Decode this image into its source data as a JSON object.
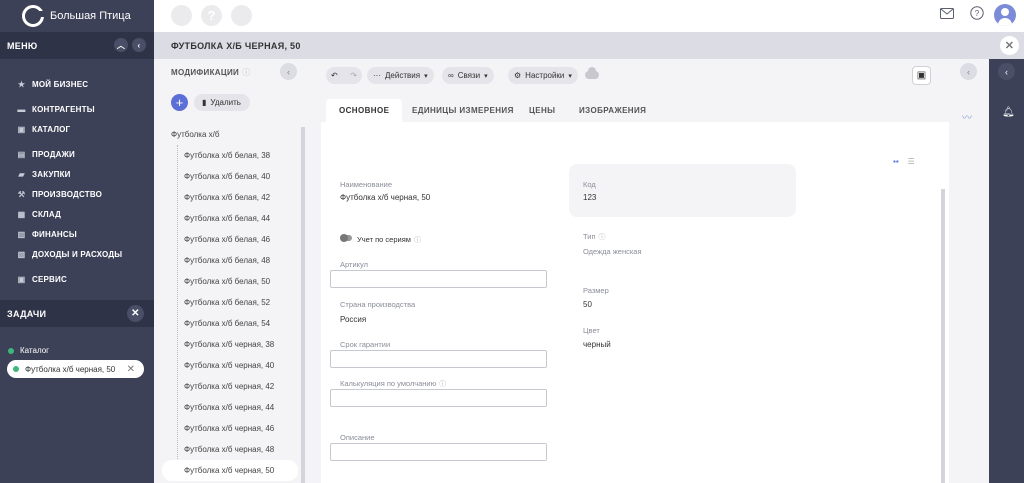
{
  "app": {
    "title": "Большая Птица"
  },
  "topbar": {
    "circle_2_label": "?",
    "mail_icon": "mail-icon",
    "help_icon": "help-icon",
    "avatar_icon": "user-avatar"
  },
  "sidebar": {
    "menu_title": "МЕНЮ",
    "items": [
      {
        "label": "МОЙ БИЗНЕС",
        "icon": "star-icon"
      },
      {
        "label": "КОНТРАГЕНТЫ",
        "icon": "people-icon"
      },
      {
        "label": "КАТАЛОГ",
        "icon": "catalog-icon"
      },
      {
        "label": "ПРОДАЖИ",
        "icon": "cart-icon"
      },
      {
        "label": "ЗАКУПКИ",
        "icon": "truck-icon"
      },
      {
        "label": "ПРОИЗВОДСТВО",
        "icon": "hammer-icon"
      },
      {
        "label": "СКЛАД",
        "icon": "warehouse-icon"
      },
      {
        "label": "ФИНАНСЫ",
        "icon": "wallet-icon"
      },
      {
        "label": "ДОХОДЫ И РАСХОДЫ",
        "icon": "chart-icon"
      },
      {
        "label": "СЕРВИС",
        "icon": "service-icon"
      }
    ],
    "tasks_title": "ЗАДАЧИ",
    "tasks": [
      {
        "label": "Каталог"
      },
      {
        "label": "Футболка х/б черная, 50"
      }
    ]
  },
  "header": {
    "title": "ФУТБОЛКА Х/Б ЧЕРНАЯ, 50"
  },
  "modifications": {
    "title": "МОДИФИКАЦИИ",
    "delete_label": "Удалить",
    "root": "Футболка х/б",
    "items": [
      "Футболка х/б белая, 38",
      "Футболка х/б белая, 40",
      "Футболка х/б белая, 42",
      "Футболка х/б белая, 44",
      "Футболка х/б белая, 46",
      "Футболка х/б белая, 48",
      "Футболка х/б белая, 50",
      "Футболка х/б белая, 52",
      "Футболка х/б белая, 54",
      "Футболка х/б черная, 38",
      "Футболка х/б черная, 40",
      "Футболка х/б черная, 42",
      "Футболка х/б черная, 44",
      "Футболка х/б черная, 46",
      "Футболка х/б черная, 48",
      "Футболка х/б черная, 50"
    ],
    "selected_index": 15
  },
  "toolbar": {
    "actions_label": "Действия",
    "links_label": "Связи",
    "settings_label": "Настройки"
  },
  "tabs": [
    "ОСНОВНОЕ",
    "ЕДИНИЦЫ ИЗМЕРЕНИЯ",
    "ЦЕНЫ",
    "ИЗОБРАЖЕНИЯ"
  ],
  "form": {
    "name_label": "Наименование",
    "name_value": "Футболка х/б черная, 50",
    "series_label": "Учет по сериям",
    "article_label": "Артикул",
    "article_value": "",
    "country_label": "Страна производства",
    "country_value": "Россия",
    "warranty_label": "Срок гарантии",
    "warranty_value": "",
    "calc_label": "Калькуляция по умолчанию",
    "calc_value": "",
    "desc_label": "Описание",
    "desc_value": "",
    "code_label": "Код",
    "code_value": "123",
    "type_label": "Тип",
    "type_value": "Одежда женская",
    "size_label": "Размер",
    "size_value": "50",
    "color_label": "Цвет",
    "color_value": "черный"
  },
  "colors": {
    "sidebar_bg": "#3d4157",
    "accent": "#5b6fd6",
    "task_dot": "#3fb67c"
  }
}
